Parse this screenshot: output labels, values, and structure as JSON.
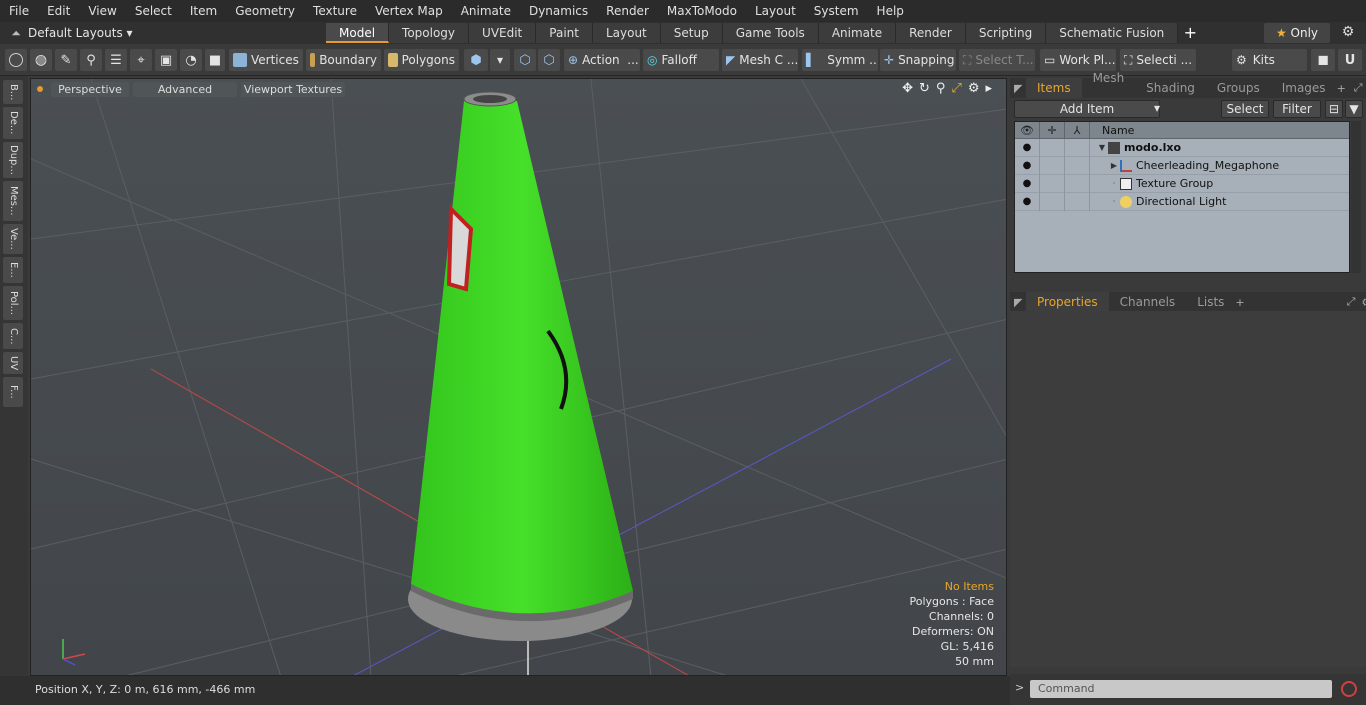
{
  "menu": [
    "File",
    "Edit",
    "View",
    "Select",
    "Item",
    "Geometry",
    "Texture",
    "Vertex Map",
    "Animate",
    "Dynamics",
    "Render",
    "MaxToModo",
    "Layout",
    "System",
    "Help"
  ],
  "layouts_label": "Default Layouts",
  "tabs": [
    "Model",
    "Topology",
    "UVEdit",
    "Paint",
    "Layout",
    "Setup",
    "Game Tools",
    "Animate",
    "Render",
    "Scripting",
    "Schematic Fusion"
  ],
  "active_tab": "Model",
  "only_label": "Only",
  "toolbar": {
    "vertices": "Vertices",
    "boundary": "Boundary",
    "polygons": "Polygons",
    "action": "Action",
    "falloff": "Falloff",
    "mesh": "Mesh C ...",
    "symm": "Symm ...",
    "snapping": "Snapping",
    "select_t": "Select T...",
    "work_pl": "Work Pl...",
    "selecti": "Selecti ...",
    "kits": "Kits"
  },
  "left_tabs": [
    "B...",
    "De...",
    "Dup...",
    "Mes...",
    "Ve...",
    "E...",
    "Pol...",
    "C...",
    "UV",
    "F..."
  ],
  "viewport": {
    "perspective": "Perspective",
    "advanced": "Advanced",
    "textures": "Viewport Textures",
    "info": {
      "no_items": "No Items",
      "polygons": "Polygons : Face",
      "channels": "Channels: 0",
      "deformers": "Deformers: ON",
      "gl": "GL: 5,416",
      "size": "50 mm"
    }
  },
  "status": "Position X, Y, Z:   0 m, 616 mm, -466 mm",
  "right_panel": {
    "tabs": [
      "Items",
      "Mesh ...",
      "Shading",
      "Groups",
      "Images"
    ],
    "active_tab": "Items",
    "add_item": "Add Item",
    "select": "Select",
    "filter": "Filter",
    "name_col": "Name",
    "tree": [
      {
        "label": "modo.lxo",
        "bold": true
      },
      {
        "label": "Cheerleading_Megaphone"
      },
      {
        "label": "Texture Group"
      },
      {
        "label": "Directional Light"
      }
    ],
    "props_tabs": [
      "Properties",
      "Channels",
      "Lists"
    ],
    "props_active": "Properties",
    "command_placeholder": "Command"
  },
  "colors": {
    "accent": "#e89a2c",
    "megaphone": "#3cd820"
  }
}
